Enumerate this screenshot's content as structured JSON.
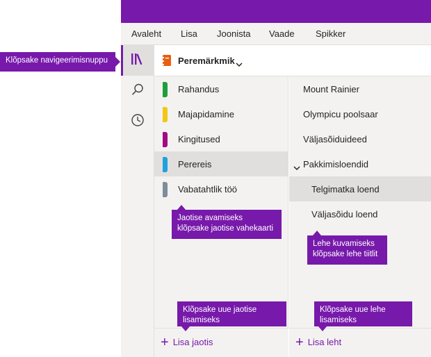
{
  "menu": {
    "items": [
      "Avaleht",
      "Lisa",
      "Joonista",
      "Vaade",
      "Spikker"
    ]
  },
  "nav_rail": {
    "icons": [
      "notebooks-icon",
      "search-icon",
      "recent-icon"
    ]
  },
  "notebook": {
    "name": "Peremärkmik",
    "icon_color": "#e8600f"
  },
  "sections": [
    {
      "label": "Rahandus",
      "color": "#1e9e3c",
      "selected": false
    },
    {
      "label": "Majapidamine",
      "color": "#f2c811",
      "selected": false
    },
    {
      "label": "Kingitused",
      "color": "#a40a80",
      "selected": false
    },
    {
      "label": "Perereis",
      "color": "#1fa1dd",
      "selected": true
    },
    {
      "label": "Vabatahtlik töö",
      "color": "#7f8c99",
      "selected": false
    }
  ],
  "pages": [
    {
      "label": "Mount Rainier",
      "level": 0,
      "selected": false
    },
    {
      "label": "Olympicu poolsaar",
      "level": 0,
      "selected": false
    },
    {
      "label": "Väljasõiduideed",
      "level": 0,
      "selected": false
    },
    {
      "label": "Pakkimisloendid",
      "level": 0,
      "selected": false,
      "expanded": true
    },
    {
      "label": "Telgimatka loend",
      "level": 1,
      "selected": true
    },
    {
      "label": "Väljasõidu loend",
      "level": 1,
      "selected": false
    }
  ],
  "buttons": {
    "add_section": "Lisa jaotis",
    "add_page": "Lisa leht"
  },
  "callouts": {
    "nav": "Klõpsake navigeerimisnuppu",
    "section_tab": "Jaotise avamiseks klõpsake jaotise vahekaarti",
    "page_title": "Lehe kuvamiseks klõpsake lehe tiitlit",
    "add_section": "Klõpsake uue jaotise lisamiseks",
    "add_page": "Klõpsake uue lehe lisamiseks"
  },
  "colors": {
    "accent": "#7719aa",
    "pane_bg": "#f3f2f1",
    "selected_bg": "#e1dfdd"
  }
}
